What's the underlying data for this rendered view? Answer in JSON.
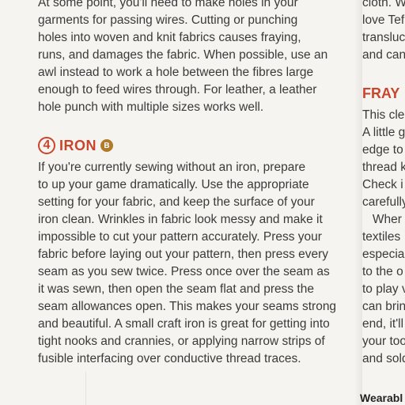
{
  "left_column": {
    "intro_lines": [
      "At some point, you'll need to make holes in your",
      "garments for passing wires. Cutting or punching",
      "holes into woven and knit fabrics causes fraying,",
      "runs, and damages the fabric. When possible, use an",
      "awl instead to work a hole between the fibres large",
      "enough to feed wires through. For leather, a leather",
      "hole punch with multiple sizes works well."
    ],
    "section": {
      "number": "4",
      "title": "IRON",
      "badge": "B"
    },
    "iron_lines": [
      "If you're currently sewing without an iron, prepare",
      "to up your game dramatically. Use the appropriate",
      "setting for your fabric, and keep the surface of your",
      "iron clean. Wrinkles in fabric look messy and make it",
      "impossible to cut your pattern accurately. Press your",
      "fabric before laying out your pattern, then press every",
      "seam as you sew twice. Press once over the seam as",
      "it was sewn, then open the seam flat and press the",
      "seam allowances open. This makes your seams strong",
      "and beautiful. A small craft iron is great for getting into",
      "tight nooks and crannies, or applying narrow strips of",
      "fusible interfacing over conductive thread traces."
    ]
  },
  "right_column": {
    "top_lines": [
      "cloth. W",
      "love Tef",
      "transluc",
      "and can"
    ],
    "heading": "FRAY",
    "lines": [
      "This cle",
      "A little g",
      "edge to",
      "thread k",
      "Check i",
      "carefully",
      "   Wher",
      "textiles",
      "especia",
      "to the o",
      "to play v",
      "can brin",
      "end, it'll",
      "your too",
      "and sold"
    ]
  },
  "footer": {
    "brand": "Wearabl"
  }
}
